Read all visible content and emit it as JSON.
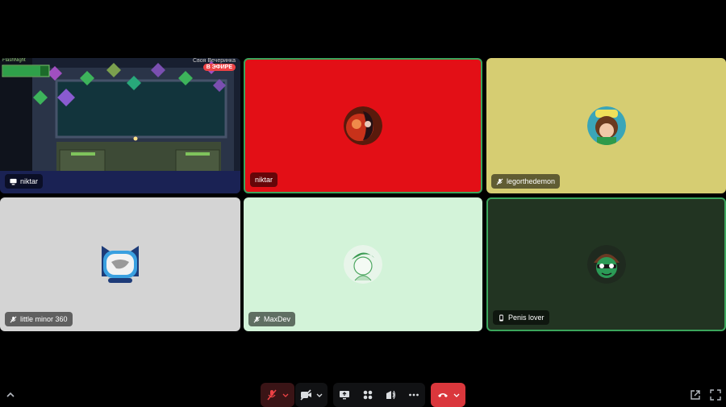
{
  "tiles": [
    {
      "name": "niktar",
      "icon": "screen-share-icon",
      "bg": "#1c2233"
    },
    {
      "name": "niktar",
      "icon": "",
      "bg": "#e30f16"
    },
    {
      "name": "legorthedemon",
      "icon": "mic-muted-icon",
      "bg": "#d6cd72"
    },
    {
      "name": "little minor 360",
      "icon": "mic-muted-icon",
      "bg": "#d4d4d4"
    },
    {
      "name": "MaxDev",
      "icon": "mic-muted-icon",
      "bg": "#d3f3d9"
    },
    {
      "name": "Penis lover",
      "icon": "phone-icon",
      "bg": "#223422"
    }
  ],
  "stream": {
    "corner_label": "FlashNight",
    "title": "Своя Вечеринка",
    "live_badge": "В ЭФИРЕ"
  },
  "colors": {
    "speaking_border": "#3ba55c",
    "hangup": "#da373c",
    "mute_red": "#da373c"
  },
  "controls": [
    "mic-muted-button",
    "camera-off-button",
    "screen-share-button",
    "activities-button",
    "soundboard-button",
    "more-button",
    "disconnect-button"
  ]
}
